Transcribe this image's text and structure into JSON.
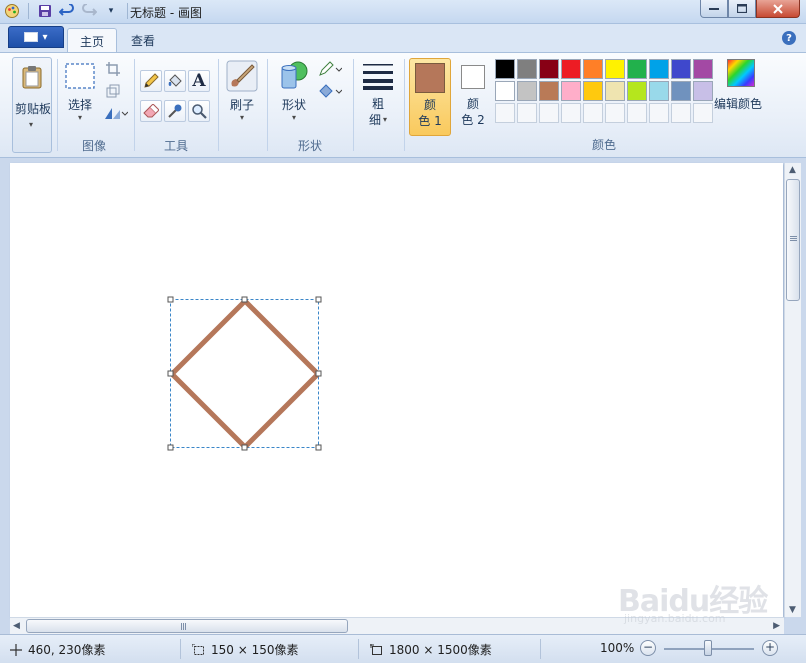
{
  "window": {
    "title": "无标题 - 画图"
  },
  "tabs": [
    {
      "label": "主页"
    },
    {
      "label": "查看"
    }
  ],
  "ribbon": {
    "clipboard": {
      "label": "剪贴板"
    },
    "image": {
      "select_label": "选择",
      "group_label": "图像"
    },
    "tools": {
      "group_label": "工具",
      "text_tool_glyph": "A"
    },
    "brushes": {
      "label": "刷子"
    },
    "shapes": {
      "label": "形状",
      "group_label": "形状"
    },
    "size": {
      "line1": "粗",
      "line2": "细"
    },
    "colors": {
      "color1_line1": "颜",
      "color1_line2": "色 1",
      "color2_line1": "颜",
      "color2_line2": "色 2",
      "edit_label": "编辑颜色",
      "group_label": "颜色",
      "color1_value": "#b5775a",
      "color2_value": "#ffffff",
      "palette_row1": [
        "#000000",
        "#7f7f7f",
        "#880015",
        "#ed1c24",
        "#ff7f27",
        "#fff200",
        "#22b14c",
        "#00a2e8",
        "#3f48cc",
        "#a349a4"
      ],
      "palette_row2": [
        "#ffffff",
        "#c3c3c3",
        "#b97a57",
        "#ffaec9",
        "#ffc90e",
        "#efe4b0",
        "#b5e61d",
        "#99d9ea",
        "#7092be",
        "#c8bfe7"
      ]
    }
  },
  "canvas": {
    "shape_color": "#b5775a",
    "selection_color": "#3a86c8"
  },
  "statusbar": {
    "cursor_pos": "460, 230像素",
    "selection_size": "150 × 150像素",
    "image_size": "1800 × 1500像素",
    "zoom": "100%",
    "zoom_minus": "−",
    "zoom_plus": "+"
  },
  "watermark": {
    "text": "Baidu经验",
    "sub": "jingyan.baidu.com"
  },
  "icons": {
    "app": "paint-app-icon",
    "save": "save-icon",
    "undo": "undo-icon",
    "redo": "redo-icon",
    "help": "help-icon",
    "pencil": "pencil-icon",
    "fill": "fill-bucket-icon",
    "text": "text-icon",
    "eraser": "eraser-icon",
    "picker": "color-picker-icon",
    "magnifier": "magnifier-icon",
    "crop": "crop-icon",
    "resize": "resize-icon",
    "rotate": "rotate-icon"
  }
}
